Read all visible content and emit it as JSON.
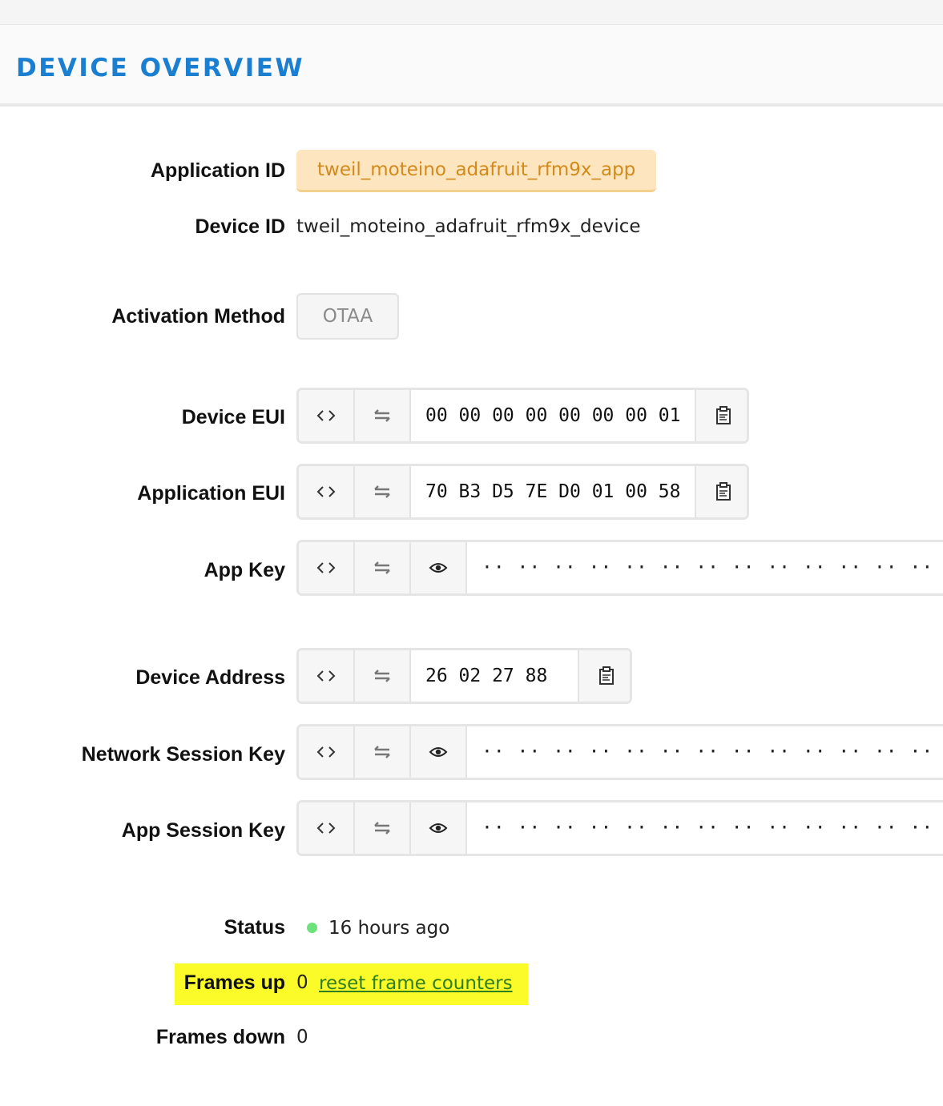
{
  "header": {
    "title": "DEVICE OVERVIEW"
  },
  "application": {
    "label": "Application ID",
    "value": "tweil_moteino_adafruit_rfm9x_app"
  },
  "device": {
    "label": "Device ID",
    "value": "tweil_moteino_adafruit_rfm9x_device"
  },
  "activation": {
    "label": "Activation Method",
    "value": "OTAA"
  },
  "device_eui": {
    "label": "Device EUI",
    "value": "00 00 00 00 00 00 00 01"
  },
  "app_eui": {
    "label": "Application EUI",
    "value": "70 B3 D5 7E D0 01 00 58"
  },
  "app_key": {
    "label": "App Key",
    "value": "·· ·· ·· ·· ·· ·· ·· ·· ·· ·· ·· ·· ·· ·· ·· ·· ·· ··"
  },
  "device_address": {
    "label": "Device Address",
    "value": "26 02 27 88"
  },
  "nwk_skey": {
    "label": "Network Session Key",
    "value": "·· ·· ·· ·· ·· ·· ·· ·· ·· ·· ·· ·· ·· ·· ·· ·· ·· ··"
  },
  "app_skey": {
    "label": "App Session Key",
    "value": "·· ·· ·· ·· ·· ·· ·· ·· ·· ·· ·· ·· ·· ·· ·· ·· ·· ··"
  },
  "status": {
    "label": "Status",
    "value": "16 hours ago",
    "dot_color": "#6be27a"
  },
  "frames_up": {
    "label": "Frames up",
    "value": "0",
    "link": "reset frame counters"
  },
  "frames_down": {
    "label": "Frames down",
    "value": "0"
  },
  "colors": {
    "title": "#1b7fd1",
    "app_id_bg": "#fde6bf",
    "app_id_text": "#d38a1c",
    "link": "#2f7e1f",
    "highlight": "#fbfb2a"
  },
  "icons": {
    "code": "code-icon",
    "byte_order": "swap-arrows-icon",
    "reveal": "eye-icon",
    "copy": "clipboard-icon"
  }
}
